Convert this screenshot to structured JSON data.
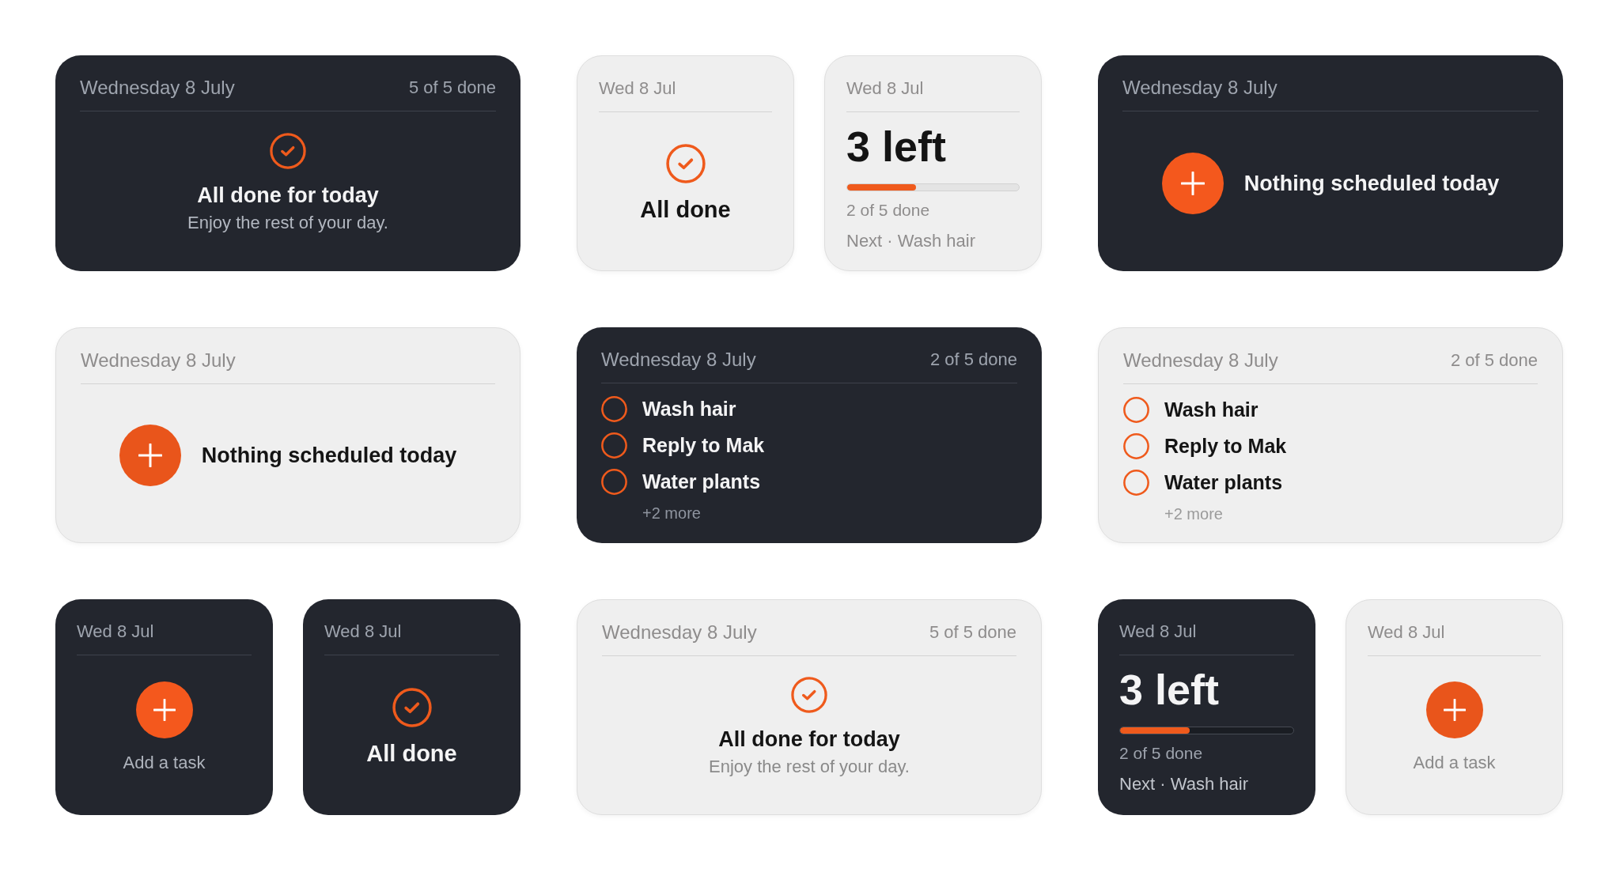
{
  "slots": [
    {
      "widgets": [
        {
          "dark": true,
          "kind": "all_done",
          "date": "Wednesday 8 July",
          "count": "5 of 5 done",
          "title": "All done for today",
          "subtitle": "Enjoy the rest of your day."
        }
      ]
    },
    {
      "widgets": [
        {
          "dark": false,
          "kind": "all_done",
          "date": "Wed 8 Jul",
          "title": "All done"
        },
        {
          "dark": false,
          "kind": "progress",
          "date": "Wed 8 Jul",
          "headline": "3 left",
          "level": 0.4,
          "summary": "2 of 5 done",
          "next": "Next · Wash hair"
        }
      ]
    },
    {
      "widgets": [
        {
          "dark": true,
          "kind": "empty",
          "date": "Wednesday 8 July",
          "title": "Nothing scheduled today"
        }
      ]
    },
    {
      "widgets": [
        {
          "dark": false,
          "kind": "empty",
          "date": "Wednesday 8 July",
          "title": "Nothing scheduled today"
        }
      ]
    },
    {
      "widgets": [
        {
          "dark": true,
          "kind": "list",
          "date": "Wednesday 8 July",
          "count": "2 of 5 done",
          "tasks": [
            {
              "label": "Wash hair",
              "checked": false
            },
            {
              "label": "Reply to Mak",
              "checked": false
            },
            {
              "label": "Water plants",
              "checked": false
            }
          ],
          "more": "+2 more"
        }
      ]
    },
    {
      "widgets": [
        {
          "dark": false,
          "kind": "list",
          "date": "Wednesday 8 July",
          "count": "2 of 5 done",
          "tasks": [
            {
              "label": "Wash hair",
              "checked": false
            },
            {
              "label": "Reply to Mak",
              "checked": false
            },
            {
              "label": "Water plants",
              "checked": false
            }
          ],
          "more": "+2 more"
        }
      ]
    },
    {
      "widgets": [
        {
          "dark": true,
          "kind": "add_task",
          "date": "Wed 8 Jul",
          "title": "Add a task"
        },
        {
          "dark": true,
          "kind": "all_done",
          "date": "Wed 8 Jul",
          "title": "All done"
        }
      ]
    },
    {
      "widgets": [
        {
          "dark": false,
          "kind": "all_done",
          "date": "Wednesday 8 July",
          "count": "5 of 5 done",
          "title": "All done for today",
          "subtitle": "Enjoy the rest of your day."
        }
      ]
    },
    {
      "widgets": [
        {
          "dark": true,
          "kind": "progress",
          "date": "Wed 8 Jul",
          "headline": "3 left",
          "level": 0.4,
          "summary": "2 of 5 done",
          "next": "Next · Wash hair"
        },
        {
          "dark": false,
          "kind": "add_task",
          "date": "Wed 8 Jul",
          "title": "Add a task"
        }
      ]
    }
  ]
}
